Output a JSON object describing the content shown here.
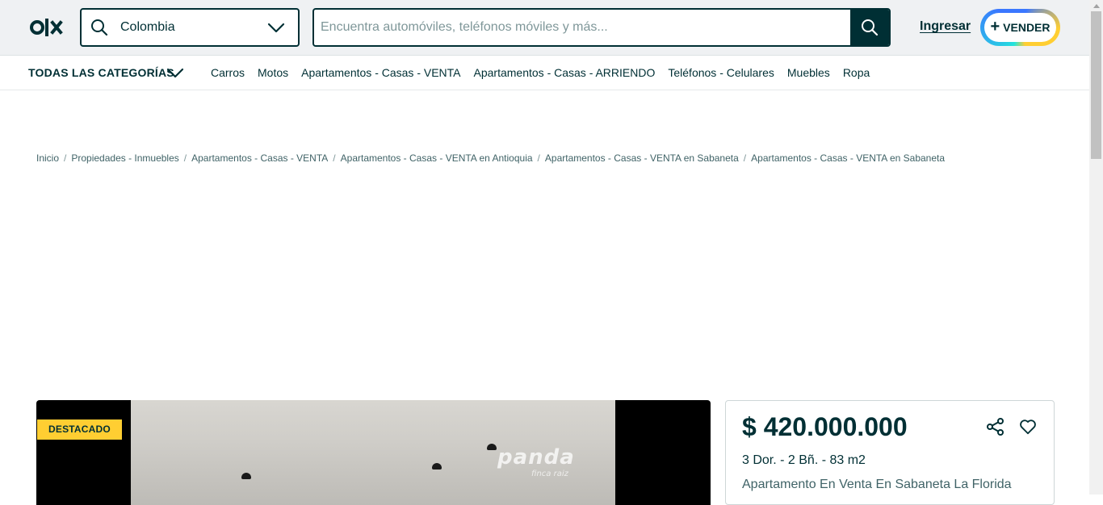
{
  "header": {
    "logo_text": "OLX",
    "location": {
      "value": "Colombia"
    },
    "search": {
      "placeholder": "Encuentra automóviles, teléfonos móviles y más..."
    },
    "login_label": "Ingresar",
    "sell_label": "VENDER"
  },
  "categories": {
    "all_label": "TODAS LAS CATEGORÍAS",
    "links": [
      "Carros",
      "Motos",
      "Apartamentos - Casas - VENTA",
      "Apartamentos - Casas - ARRIENDO",
      "Teléfonos - Celulares",
      "Muebles",
      "Ropa"
    ]
  },
  "breadcrumb": [
    "Inicio",
    "Propiedades - Inmuebles",
    "Apartamentos - Casas - VENTA",
    "Apartamentos - Casas - VENTA en Antioquia",
    "Apartamentos - Casas - VENTA en Sabaneta",
    "Apartamentos - Casas - VENTA en Sabaneta"
  ],
  "listing": {
    "badge": "DESTACADO",
    "price": "$ 420.000.000",
    "specs": "3 Dor. - 2 Bñ. - 83 m2",
    "title": "Apartamento En Venta En Sabaneta La Florida",
    "watermark": "panda",
    "watermark_sub": "finca raiz"
  },
  "colors": {
    "brand": "#002f34",
    "badge": "#ffce32",
    "topbar_bg": "#eff1f3"
  }
}
